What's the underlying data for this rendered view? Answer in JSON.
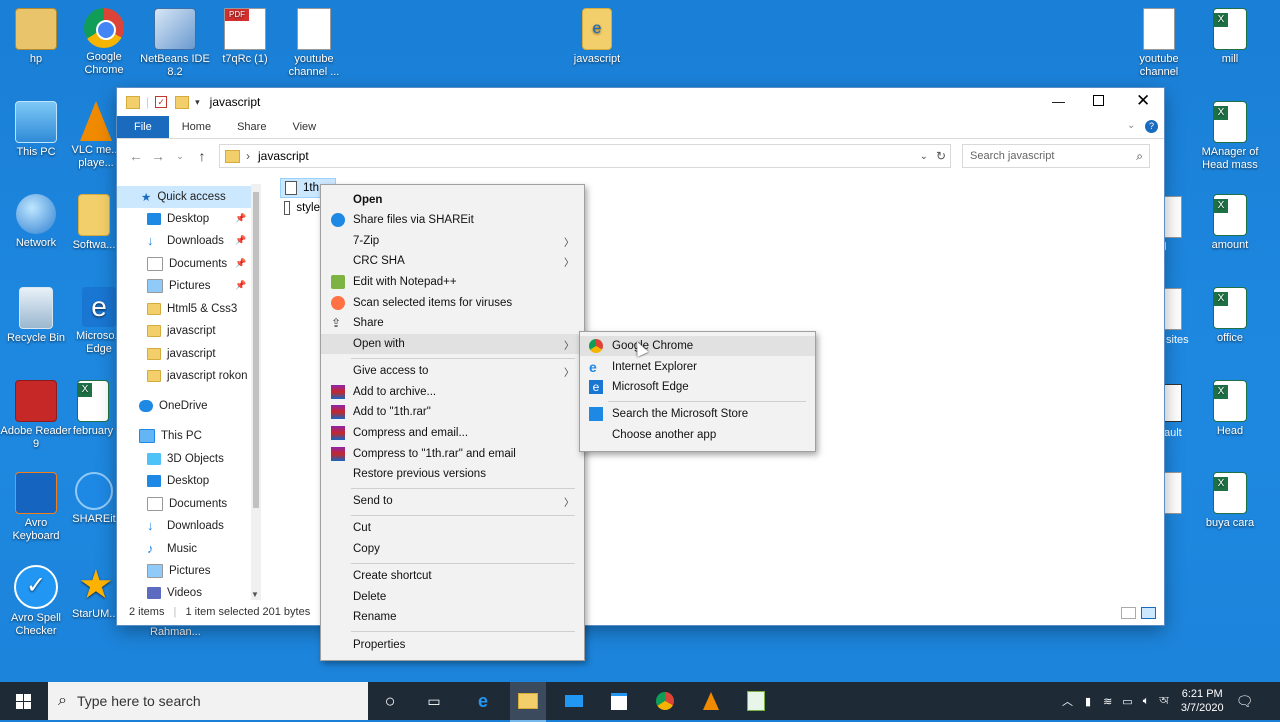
{
  "desktop": {
    "icons_left": [
      {
        "label": "hp"
      },
      {
        "label": "Google Chrome"
      },
      {
        "label": "NetBeans IDE 8.2"
      },
      {
        "label": "t7qRc (1)"
      },
      {
        "label": "youtube channel ..."
      },
      {
        "label": "This PC"
      },
      {
        "label": "VLC me... playe..."
      },
      {
        "label": "Network"
      },
      {
        "label": "Softwa..."
      },
      {
        "label": "Recycle Bin"
      },
      {
        "label": "Microso... Edge"
      },
      {
        "label": "Adobe Reader 9"
      },
      {
        "label": "february"
      },
      {
        "label": "Avro Keyboard"
      },
      {
        "label": "SHAREit"
      },
      {
        "label": "Avro Spell Checker"
      },
      {
        "label": "StarUM..."
      }
    ],
    "icons_center": [
      {
        "label": "javascript"
      }
    ],
    "icons_right": [
      {
        "label": "youtube channel"
      },
      {
        "label": "mill"
      },
      {
        "label": "MAnager of Head mass"
      },
      {
        "label": "amount"
      },
      {
        "label": "office"
      },
      {
        "label": "Head"
      },
      {
        "label": "buya cara"
      }
    ],
    "partial_labels": {
      "sites": "sites",
      "ault": "ault",
      "l": "l",
      "rahman": "Rahman..."
    }
  },
  "explorer": {
    "title": "javascript",
    "ribbon_tabs": [
      "File",
      "Home",
      "Share",
      "View"
    ],
    "breadcrumb": "javascript",
    "search_placeholder": "Search javascript",
    "nav": {
      "quick_access": "Quick access",
      "quick_items": [
        "Desktop",
        "Downloads",
        "Documents",
        "Pictures",
        "Html5 & Css3",
        "javascript",
        "javascript",
        "javascript rokon"
      ],
      "onedrive": "OneDrive",
      "this_pc": "This PC",
      "pc_items": [
        "3D Objects",
        "Desktop",
        "Documents",
        "Downloads",
        "Music",
        "Pictures",
        "Videos"
      ]
    },
    "files": [
      {
        "name": "1th"
      },
      {
        "name": "style"
      }
    ],
    "status": {
      "count": "2 items",
      "selected": "1 item selected  201 bytes"
    }
  },
  "context_menu": {
    "items": [
      {
        "label": "Open",
        "bold": true
      },
      {
        "label": "Share files via SHAREit"
      },
      {
        "label": "7-Zip"
      },
      {
        "label": "CRC SHA"
      },
      {
        "label": "Edit with Notepad++"
      },
      {
        "label": "Scan selected items for viruses"
      },
      {
        "label": "Share"
      },
      {
        "label": "Open with"
      },
      {
        "label": "Give access to"
      },
      {
        "label": "Add to archive..."
      },
      {
        "label": "Add to \"1th.rar\""
      },
      {
        "label": "Compress and email..."
      },
      {
        "label": "Compress to \"1th.rar\" and email"
      },
      {
        "label": "Restore previous versions"
      },
      {
        "label": "Send to"
      },
      {
        "label": "Cut"
      },
      {
        "label": "Copy"
      },
      {
        "label": "Create shortcut"
      },
      {
        "label": "Delete"
      },
      {
        "label": "Rename"
      },
      {
        "label": "Properties"
      }
    ]
  },
  "open_with_submenu": {
    "items": [
      {
        "label": "Google Chrome"
      },
      {
        "label": "Internet Explorer"
      },
      {
        "label": "Microsoft Edge"
      },
      {
        "label": "Search the Microsoft Store"
      },
      {
        "label": "Choose another app"
      }
    ]
  },
  "taskbar": {
    "search_placeholder": "Type here to search",
    "time": "6:21 PM",
    "date": "3/7/2020"
  },
  "colors": {
    "desktop": "#1e88e0",
    "file_tab": "#1a6bbd",
    "taskbar": "#1f2a37"
  }
}
